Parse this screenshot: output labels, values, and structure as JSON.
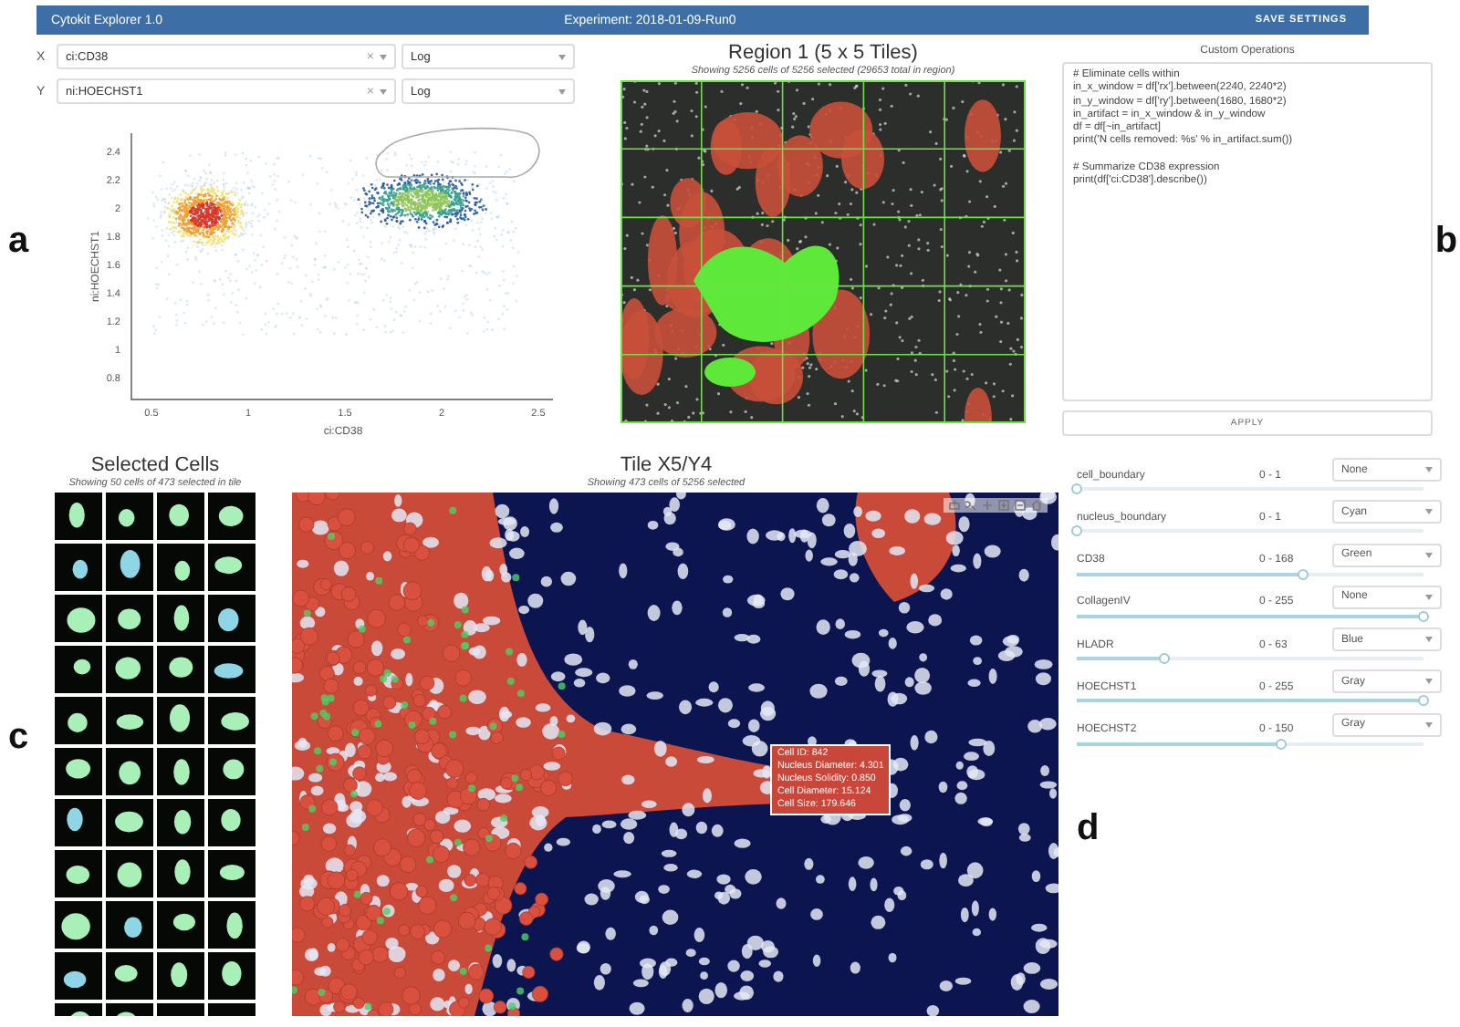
{
  "header": {
    "app_title": "Cytokit Explorer 1.0",
    "experiment": "Experiment: 2018-01-09-Run0",
    "save_button": "SAVE SETTINGS"
  },
  "panel_labels": [
    "a",
    "b",
    "c",
    "d"
  ],
  "axis_selectors": [
    {
      "axis": "X",
      "feature": "ci:CD38",
      "clear": "×",
      "scale": "Log"
    },
    {
      "axis": "Y",
      "feature": "ni:HOECHST1",
      "clear": "×",
      "scale": "Log"
    }
  ],
  "plot": {
    "x_axis_label": "ci:CD38",
    "y_axis_label": "ni:HOECHST1",
    "x_tick_labels": [
      "0.5",
      "1",
      "1.5",
      "2",
      "2.5"
    ],
    "y_tick_labels": [
      "2.4",
      "2.2",
      "2",
      "1.8",
      "1.6",
      "1.4",
      "1.2",
      "1",
      "0.8"
    ]
  },
  "region": {
    "title": "Region 1 (5 x 5 Tiles)",
    "subtitle": "Showing 5256 cells of 5256 selected (29653 total in region)"
  },
  "custom_operations": {
    "title": "Custom Operations",
    "code": "# Eliminate cells within\nin_x_window = df['rx'].between(2240, 2240*2)\nin_y_window = df['ry'].between(1680, 1680*2)\nin_artifact = in_x_window & in_y_window\ndf = df[~in_artifact]\nprint('N cells removed: %s' % in_artifact.sum())\n\n# Summarize CD38 expression\nprint(df['ci:CD38'].describe())",
    "apply_button": "APPLY"
  },
  "selected_cells": {
    "title": "Selected Cells",
    "subtitle": "Showing 50 cells of 473 selected in tile"
  },
  "tile": {
    "title": "Tile X5/Y4",
    "subtitle": "Showing 473 cells of 5256 selected",
    "tooltip": [
      "Cell ID: 842",
      "Nucleus Diameter: 4.301",
      "Nucleus Solidity: 0.850",
      "Cell Diameter: 15.124",
      "Cell Size: 179.646"
    ]
  },
  "channels": [
    {
      "name": "cell_boundary",
      "range": "0 - 1",
      "color_mode": "None",
      "level": 0
    },
    {
      "name": "nucleus_boundary",
      "range": "0 - 1",
      "color_mode": "Cyan",
      "level": 0
    },
    {
      "name": "CD38",
      "range": "0 - 168",
      "color_mode": "Green",
      "level": 0.65
    },
    {
      "name": "CollagenIV",
      "range": "0 - 255",
      "color_mode": "None",
      "level": 1
    },
    {
      "name": "HLADR",
      "range": "0 - 63",
      "color_mode": "Blue",
      "level": 0.25
    },
    {
      "name": "HOECHST1",
      "range": "0 - 255",
      "color_mode": "Gray",
      "level": 1
    },
    {
      "name": "HOECHST2",
      "range": "0 - 150",
      "color_mode": "Gray",
      "level": 0.59
    }
  ]
}
